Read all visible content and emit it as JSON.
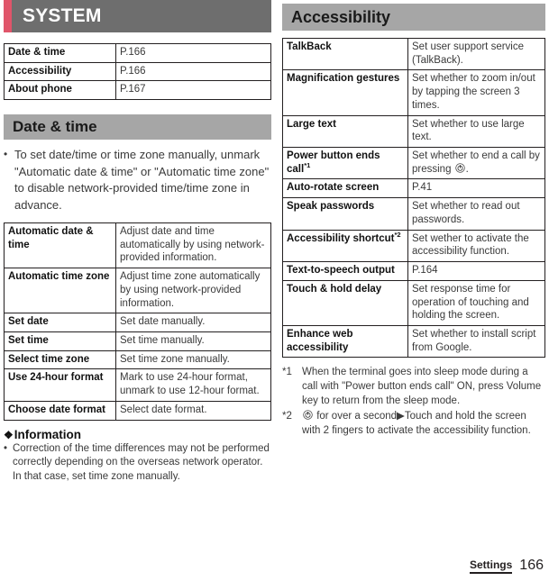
{
  "left": {
    "section_header": {
      "title": "SYSTEM",
      "accent_color": "#e0556a",
      "bar_color": "#6e6e6e"
    },
    "toc_table": {
      "rows": [
        {
          "key": "Date & time",
          "value": "P.166"
        },
        {
          "key": "Accessibility",
          "value": "P.166"
        },
        {
          "key": "About phone",
          "value": "P.167"
        }
      ]
    },
    "subsection_header": {
      "title": "Date & time",
      "bar_color": "#a6a6a6"
    },
    "intro_bullet": {
      "marker": "•",
      "text": "To set date/time or time zone manually, unmark \"Automatic date & time\" or \"Automatic time zone\" to disable network-provided time/time zone in advance."
    },
    "settings_table": {
      "rows": [
        {
          "key": "Automatic date & time",
          "value": "Adjust date and time automatically by using network-provided information."
        },
        {
          "key": "Automatic time zone",
          "value": "Adjust time zone automatically by using network-provided information."
        },
        {
          "key": "Set date",
          "value": "Set date manually."
        },
        {
          "key": "Set time",
          "value": "Set time manually."
        },
        {
          "key": "Select time zone",
          "value": "Set time zone manually."
        },
        {
          "key": "Use 24-hour format",
          "value": "Mark to use 24-hour format, unmark to use 12-hour format."
        },
        {
          "key": "Choose date format",
          "value": "Select date format."
        }
      ]
    },
    "information": {
      "diamond": "❖",
      "title": "Information",
      "bullet_marker": "•",
      "bullet_text": "Correction of the time differences may not be performed correctly depending on the overseas network operator. In that case, set time zone manually."
    }
  },
  "right": {
    "section_header": {
      "title": "Accessibility",
      "bar_color": "#a6a6a6"
    },
    "settings_table": {
      "rows": [
        {
          "key": "TalkBack",
          "sup": "",
          "value_pre": "Set user support service (TalkBack).",
          "value_post": "",
          "icon": ""
        },
        {
          "key": "Magnification gestures",
          "sup": "",
          "value_pre": "Set whether to zoom in/out by tapping the screen 3 times.",
          "value_post": "",
          "icon": ""
        },
        {
          "key": "Large text",
          "sup": "",
          "value_pre": "Set whether to use large text.",
          "value_post": "",
          "icon": ""
        },
        {
          "key": "Power button ends call",
          "sup": "*1",
          "value_pre": "Set whether to end a call by pressing ",
          "value_post": ".",
          "icon": "power-button-icon"
        },
        {
          "key": "Auto-rotate screen",
          "sup": "",
          "value_pre": "P.41",
          "value_post": "",
          "icon": ""
        },
        {
          "key": "Speak passwords",
          "sup": "",
          "value_pre": "Set whether to read out passwords.",
          "value_post": "",
          "icon": ""
        },
        {
          "key": "Accessibility shortcut",
          "sup": "*2",
          "value_pre": "Set wether to activate the accessibility function.",
          "value_post": "",
          "icon": ""
        },
        {
          "key": "Text-to-speech output",
          "sup": "",
          "value_pre": "P.164",
          "value_post": "",
          "icon": ""
        },
        {
          "key": "Touch & hold delay",
          "sup": "",
          "value_pre": "Set response time for operation of touching and holding the screen.",
          "value_post": "",
          "icon": ""
        },
        {
          "key": "Enhance web accessibility",
          "sup": "",
          "value_pre": "Set whether to install script from Google.",
          "value_post": "",
          "icon": ""
        }
      ]
    },
    "footnotes": [
      {
        "marker": "*1",
        "text_pre": "When the terminal goes into sleep mode during a call with \"Power button ends call\" ON, press Volume key to return from the sleep mode.",
        "icon": "",
        "text_post": ""
      },
      {
        "marker": "*2",
        "text_pre": "",
        "icon": "power-button-icon",
        "text_post": " for over a second▶Touch and hold the screen with 2 fingers to activate the accessibility function."
      }
    ]
  },
  "footer": {
    "label": "Settings",
    "page_number": "166"
  }
}
